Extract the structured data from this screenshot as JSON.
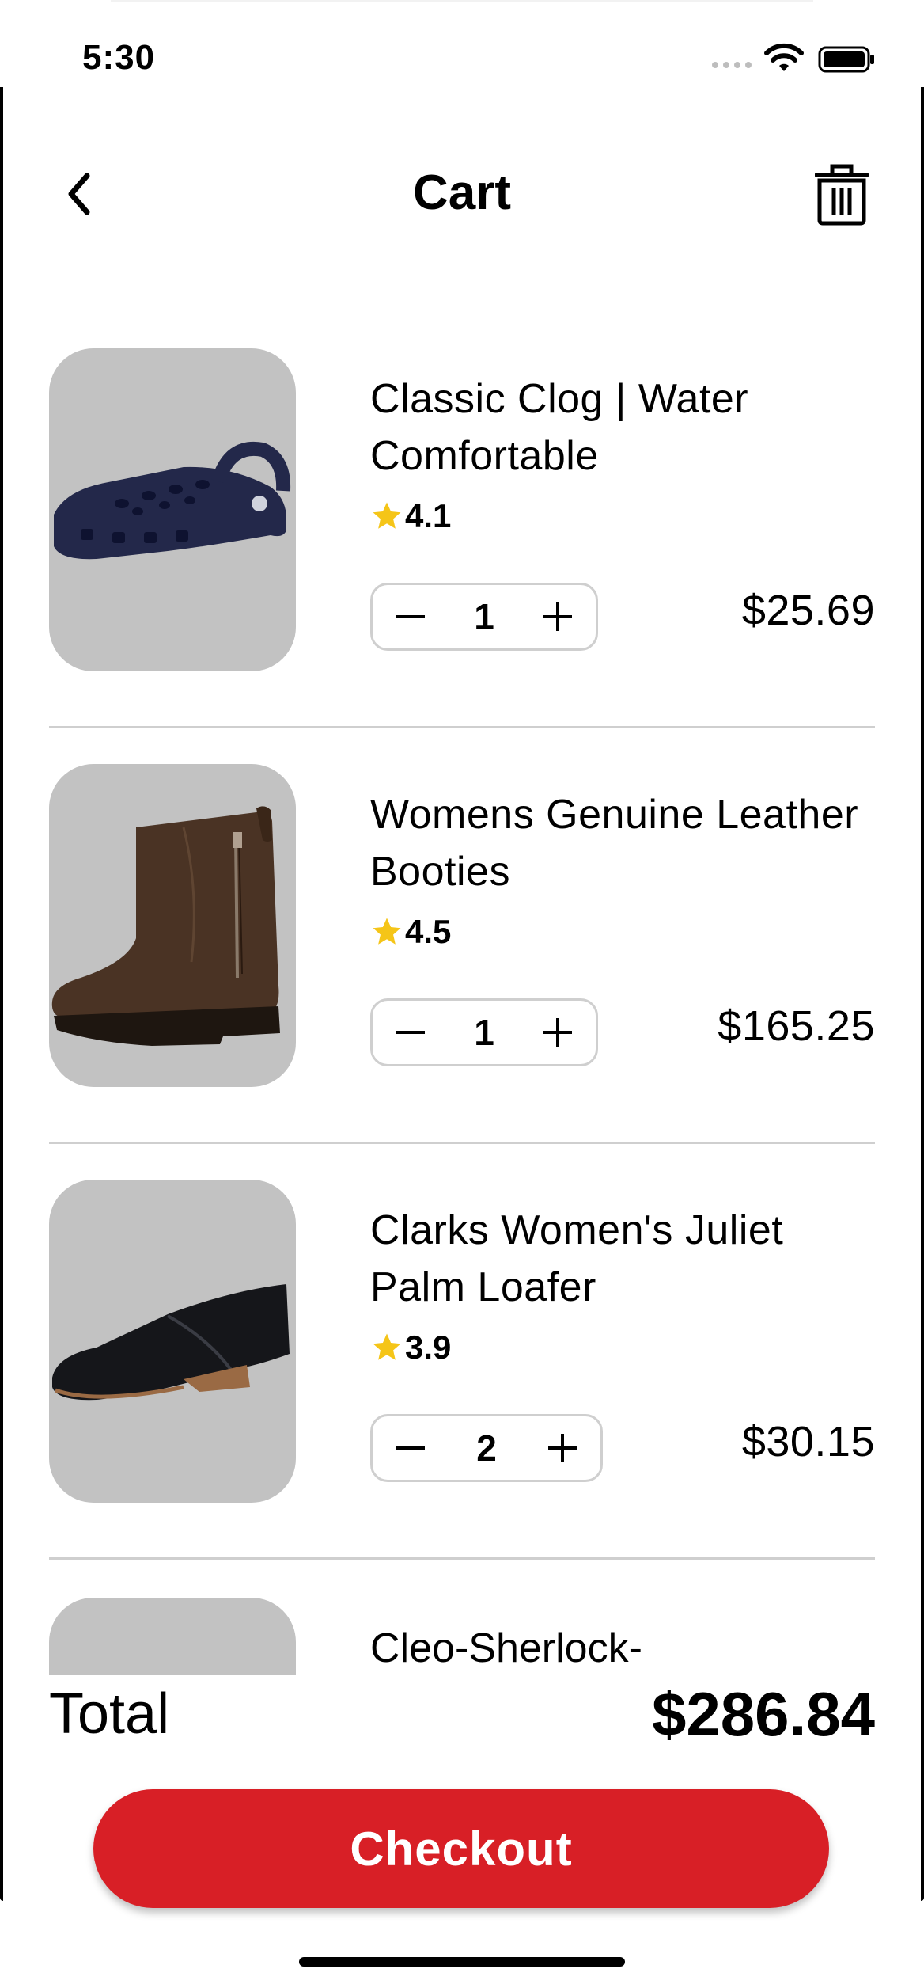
{
  "status_bar": {
    "time": "5:30"
  },
  "header": {
    "title": "Cart"
  },
  "items": [
    {
      "name": "Classic Clog | Water Comfortable",
      "rating": "4.1",
      "quantity": "1",
      "price": "$25.69",
      "image": "navy-clog"
    },
    {
      "name": "Womens Genuine Leather Booties",
      "rating": "4.5",
      "quantity": "1",
      "price": "$165.25",
      "image": "brown-ankle-boot"
    },
    {
      "name": "Clarks Women's Juliet Palm Loafer",
      "rating": "3.9",
      "quantity": "2",
      "price": "$30.15",
      "image": "black-loafer"
    },
    {
      "name": "Cleo-Sherlock-",
      "image": ""
    }
  ],
  "summary": {
    "total_label": "Total",
    "total_value": "$286.84"
  },
  "checkout": {
    "label": "Checkout"
  },
  "colors": {
    "accent": "#d81f26",
    "thumb_bg": "#c2c2c2",
    "star": "#f5c518",
    "divider": "#cfcfcf"
  }
}
